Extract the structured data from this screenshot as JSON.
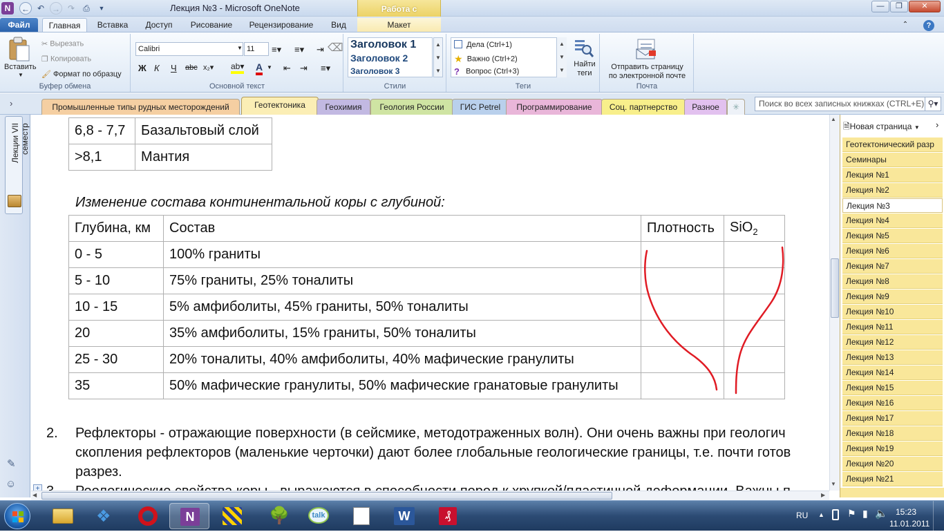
{
  "window": {
    "title": "Лекция №3  -  Microsoft OneNote",
    "context_tab": "Работа с таблицами",
    "context_sub": "Макет"
  },
  "ribbon_tabs": [
    "Файл",
    "Главная",
    "Вставка",
    "Доступ",
    "Рисование",
    "Рецензирование",
    "Вид"
  ],
  "clipboard": {
    "paste": "Вставить",
    "cut": "Вырезать",
    "copy": "Копировать",
    "format_painter": "Формат по образцу",
    "group": "Буфер обмена"
  },
  "font": {
    "family": "Calibri",
    "size": "11",
    "group": "Основной текст"
  },
  "styles": {
    "h1": "Заголовок 1",
    "h2": "Заголовок 2",
    "h3": "Заголовок 3",
    "group": "Стили"
  },
  "tags": {
    "todo": "Дела (Ctrl+1)",
    "important": "Важно (Ctrl+2)",
    "question": "Вопрос (Ctrl+3)",
    "find": "Найти",
    "find2": "теги",
    "group": "Теги"
  },
  "email": {
    "line1": "Отправить страницу",
    "line2": "по электронной почте",
    "group": "Почта"
  },
  "sections": [
    "Промышленные типы рудных месторождений",
    "Геотектоника",
    "Геохимия",
    "Геология России",
    "ГИС Petrel",
    "Программирование",
    "Соц. партнерство",
    "Разное"
  ],
  "search": {
    "placeholder": "Поиск во всех записных книжках (CTRL+E)"
  },
  "notebook": {
    "name": "Лекции VII семестр"
  },
  "top_table": [
    [
      "6,8 - 7,7",
      "Базальтовый слой"
    ],
    [
      ">8,1",
      "Мантия"
    ]
  ],
  "caption": "Изменение состава континентальной коры с глубиной:",
  "main_table": {
    "headers": [
      "Глубина, км",
      "Состав",
      "Плотность",
      "SiO",
      "2"
    ],
    "rows": [
      [
        "0 - 5",
        "100% граниты"
      ],
      [
        "5 - 10",
        "75% граниты, 25% тоналиты"
      ],
      [
        "10 - 15",
        "5% амфиболиты, 45% граниты, 50%  тоналиты"
      ],
      [
        "20",
        "35% амфиболиты, 15% граниты, 50% тоналиты"
      ],
      [
        "25 - 30",
        "20% тоналиты, 40% амфиболиты, 40%  мафические гранулиты"
      ],
      [
        "35",
        "50% мафические гранулиты, 50% мафические гранатовые гранулиты"
      ]
    ]
  },
  "paragraphs": {
    "p2_num": "2.",
    "p2_l1": "Рефлекторы - отражающие поверхности (в сейсмике, методотраженных волн). Они очень важны при геологич",
    "p2_l2": "скопления рефлекторов (маленькие черточки) дают более глобальные геологические границы, т.е. почти готов",
    "p2_l3": "разрез.",
    "p3_num": "3.",
    "p3_l1": "Реологические свойства коры - выражаются в способности пород к хрупкой/пластичной деформации. Важны п"
  },
  "pages_panel": {
    "new_page": "Новая страница",
    "items": [
      "Геотектонический разр",
      "Семинары",
      "Лекция №1",
      "Лекция №2",
      "Лекция №3",
      "Лекция №4",
      "Лекция №5",
      "Лекция №6",
      "Лекция №7",
      "Лекция №8",
      "Лекция №9",
      "Лекция №10",
      "Лекция №11",
      "Лекция №12",
      "Лекция №13",
      "Лекция №14",
      "Лекция №15",
      "Лекция №16",
      "Лекция №17",
      "Лекция №18",
      "Лекция №19",
      "Лекция №20",
      "Лекция №21"
    ],
    "active": "Лекция №3"
  },
  "taskbar": {
    "lang": "RU",
    "time": "15:23",
    "date": "11.01.2011"
  },
  "colors": {
    "ink": "#e01b24",
    "page_tab": "#f9e79a",
    "file_tab": "#2b63ad"
  }
}
